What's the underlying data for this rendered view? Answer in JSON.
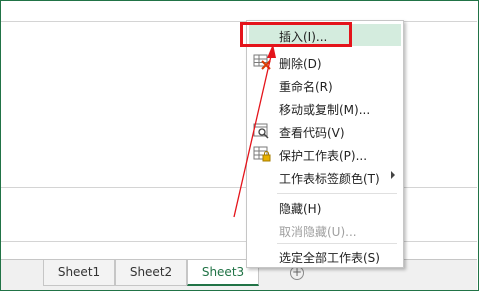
{
  "sheet_tabs": [
    {
      "label": "Sheet1",
      "active": false
    },
    {
      "label": "Sheet2",
      "active": false
    },
    {
      "label": "Sheet3",
      "active": true
    }
  ],
  "add_sheet_glyph": "+",
  "context_menu": {
    "items": [
      {
        "label": "插入(I)...",
        "icon": "",
        "highlighted": true,
        "disabled": false
      },
      {
        "label": "删除(D)",
        "icon": "delete-sheet-icon",
        "highlighted": false,
        "disabled": false
      },
      {
        "label": "重命名(R)",
        "icon": "",
        "highlighted": false,
        "disabled": false
      },
      {
        "label": "移动或复制(M)...",
        "icon": "",
        "highlighted": false,
        "disabled": false
      },
      {
        "label": "查看代码(V)",
        "icon": "view-code-icon",
        "highlighted": false,
        "disabled": false
      },
      {
        "label": "保护工作表(P)...",
        "icon": "protect-sheet-icon",
        "highlighted": false,
        "disabled": false
      },
      {
        "label": "工作表标签颜色(T)",
        "icon": "",
        "highlighted": false,
        "disabled": false,
        "submenu": true
      },
      {
        "label": "隐藏(H)",
        "icon": "",
        "highlighted": false,
        "disabled": false
      },
      {
        "label": "取消隐藏(U)...",
        "icon": "",
        "highlighted": false,
        "disabled": true
      },
      {
        "label": "选定全部工作表(S)",
        "icon": "",
        "highlighted": false,
        "disabled": false
      }
    ]
  },
  "colors": {
    "accent_green": "#217346",
    "menu_highlight": "#d4ecde",
    "annotation_red": "#e4141b"
  }
}
